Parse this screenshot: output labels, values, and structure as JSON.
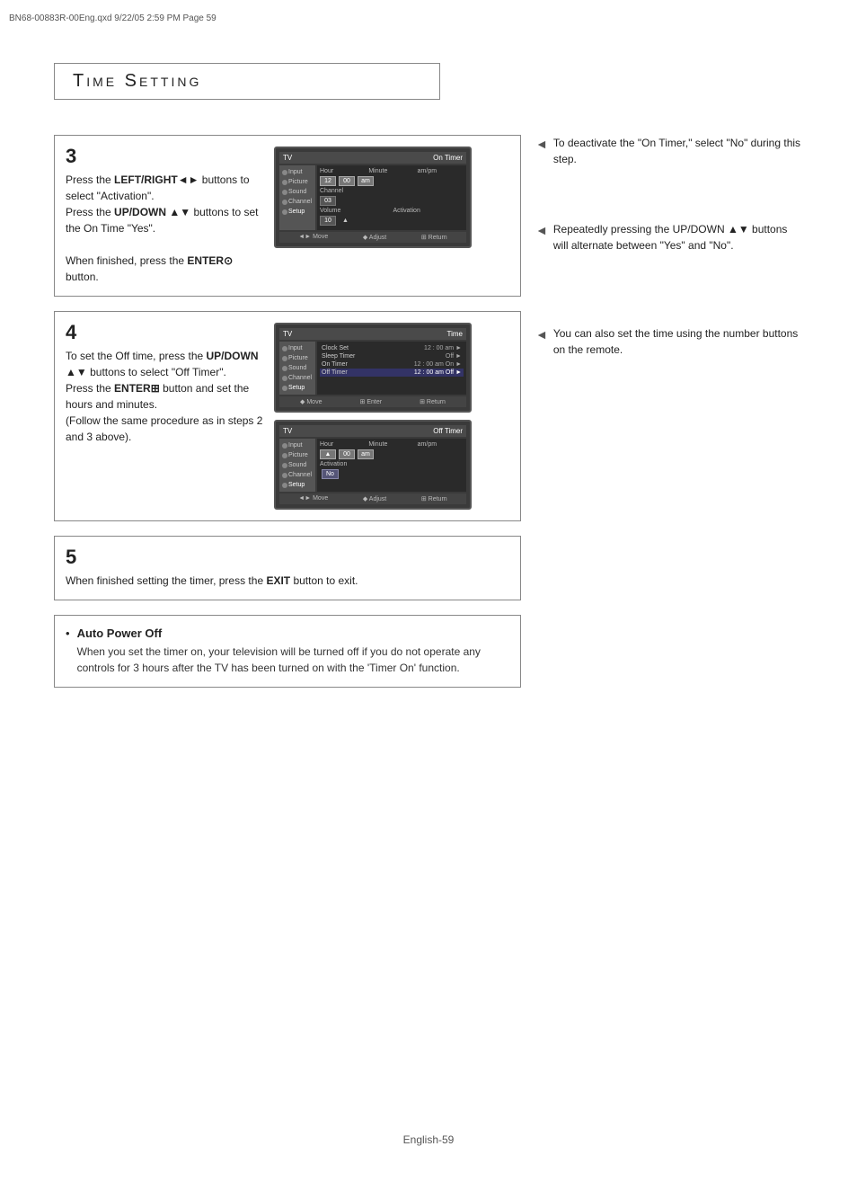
{
  "header": {
    "file_info": "BN68-00883R-00Eng.qxd   9/22/05  2:59 PM   Page 59"
  },
  "title": "Time Setting",
  "step3": {
    "number": "3",
    "text_parts": [
      "Press the ",
      "LEFT/RIGHT",
      " buttons to select \"Activation\".",
      "Press the ",
      "UP/DOWN",
      "▲▼",
      " buttons to set the On Time \"Yes\".",
      "When finished, press the ",
      "ENTER",
      " button."
    ],
    "text": "Press the LEFT/RIGHT◄► buttons to select \"Activation\". Press the UP/DOWN ▲▼ buttons to set the On Time \"Yes\".\n\nWhen finished, press the ENTER⊙ button.",
    "tv_screen": {
      "title": "On Timer",
      "sidebar_items": [
        "Input",
        "Picture",
        "Sound",
        "Channel",
        "Setup"
      ],
      "row1_labels": [
        "Hour",
        "Minute",
        "am/pm"
      ],
      "row1_values": [
        "12",
        "00",
        "am"
      ],
      "row2_label": "Channel",
      "row2_value": "03",
      "row3_label": "Volume  Activation",
      "row3_value": "10",
      "footer": [
        "◄► Move",
        "◆ Adjust",
        "⊞ Return"
      ]
    }
  },
  "step4": {
    "number": "4",
    "text": "To set the Off time, press the UP/DOWN ▲▼ buttons to select \"Off Timer\". Press the ENTER⊞ button and set the hours and minutes. (Follow the same procedure as in steps 2 and 3 above).",
    "tv_screen1": {
      "title": "Time",
      "sidebar_items": [
        "Input",
        "Picture",
        "Sound",
        "Channel",
        "Setup"
      ],
      "menu_rows": [
        {
          "label": "Clock Set",
          "value": "12 : 00  am",
          "arrow": "►"
        },
        {
          "label": "Sleep Timer",
          "value": "Off",
          "arrow": "►"
        },
        {
          "label": "On Timer",
          "value": "12 : 00  am On",
          "arrow": "►"
        },
        {
          "label": "Off Timer",
          "value": "12 : 00  am Off",
          "arrow": "►",
          "highlighted": true
        }
      ],
      "footer": [
        "◆ Move",
        "⊞ Enter",
        "⊞ Return"
      ]
    },
    "tv_screen2": {
      "title": "Off Timer",
      "sidebar_items": [
        "Input",
        "Picture",
        "Sound",
        "Channel",
        "Setup"
      ],
      "row1_labels": [
        "Hour",
        "Minute",
        "am/pm"
      ],
      "row1_values": [
        "▲",
        "00",
        "am"
      ],
      "activation_label": "Activation",
      "activation_value": "No",
      "footer": [
        "◄► Move",
        "◆ Adjust",
        "⊞ Return"
      ]
    }
  },
  "right_notes": {
    "note1": "To deactivate the \"On Timer,\" select \"No\" during this step.",
    "note2": "Repeatedly pressing the UP/DOWN ▲▼ buttons will alternate between \"Yes\" and \"No\".",
    "note3": "You can also set the time using the number buttons on the remote."
  },
  "step5": {
    "number": "5",
    "text": "When finished setting the timer, press the EXIT button to exit.",
    "exit_bold": "EXIT"
  },
  "info_block": {
    "bullet": "•",
    "title": "Auto Power Off",
    "text": "When you set the timer on, your television will be turned off if you do not operate any controls for 3 hours after the TV has been turned on with the 'Timer On' function."
  },
  "footer": {
    "page_label": "English-",
    "page_number": "59"
  }
}
